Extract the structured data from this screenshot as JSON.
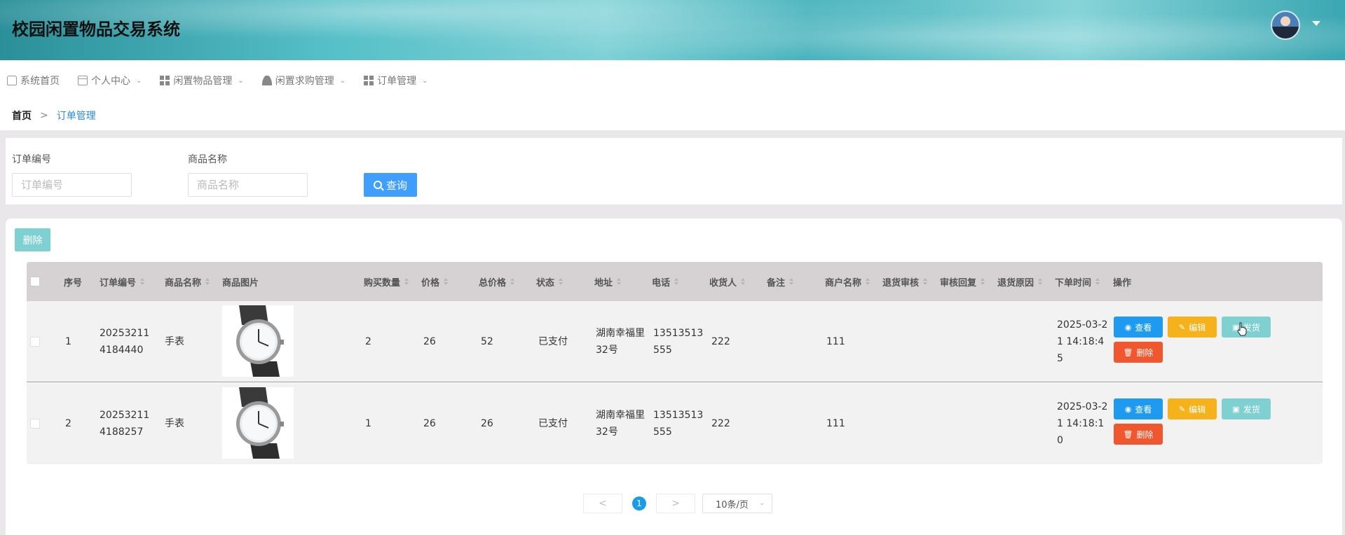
{
  "app": {
    "title": "校园闲置物品交易系统"
  },
  "nav": {
    "items": [
      {
        "label": "系统首页",
        "icon": "home-icon",
        "has_dropdown": false
      },
      {
        "label": "个人中心",
        "icon": "card-icon",
        "has_dropdown": true
      },
      {
        "label": "闲置物品管理",
        "icon": "grid-icon",
        "has_dropdown": true
      },
      {
        "label": "闲置求购管理",
        "icon": "user-icon",
        "has_dropdown": true
      },
      {
        "label": "订单管理",
        "icon": "grid-icon",
        "has_dropdown": true
      }
    ]
  },
  "breadcrumb": {
    "home": "首页",
    "separator": ">",
    "current": "订单管理"
  },
  "search": {
    "order_no_label": "订单编号",
    "order_no_placeholder": "订单编号",
    "product_label": "商品名称",
    "product_placeholder": "商品名称",
    "query_button": "查询"
  },
  "toolbar": {
    "delete_label": "删除"
  },
  "table": {
    "columns": [
      "序号",
      "订单编号",
      "商品名称",
      "商品图片",
      "购买数量",
      "价格",
      "总价格",
      "状态",
      "地址",
      "电话",
      "收货人",
      "备注",
      "商户名称",
      "退货审核",
      "审核回复",
      "退货原因",
      "下单时间",
      "操作"
    ],
    "rows": [
      {
        "index": "1",
        "order_no": "202532114184440",
        "product": "手表",
        "quantity": "2",
        "price": "26",
        "total": "52",
        "status": "已支付",
        "address": "湖南幸福里32号",
        "phone": "13513513555",
        "receiver": "222",
        "note": "",
        "merchant": "111",
        "return_review": "",
        "review_reply": "",
        "return_reason": "",
        "order_time": "2025-03-21 14:18:45"
      },
      {
        "index": "2",
        "order_no": "202532114188257",
        "product": "手表",
        "quantity": "1",
        "price": "26",
        "total": "26",
        "status": "已支付",
        "address": "湖南幸福里32号",
        "phone": "13513513555",
        "receiver": "222",
        "note": "",
        "merchant": "111",
        "return_review": "",
        "review_reply": "",
        "return_reason": "",
        "order_time": "2025-03-21 14:18:10"
      }
    ],
    "actions": {
      "view": "查看",
      "edit": "编辑",
      "ship": "发货",
      "delete": "删除"
    }
  },
  "pagination": {
    "prev": "<",
    "current": "1",
    "next": ">",
    "page_size": "10条/页"
  },
  "colors": {
    "primary": "#409eff",
    "view": "#1e9bf0",
    "edit": "#f6b21a",
    "ship": "#7fd0d1",
    "delete": "#f1572e",
    "breadcrumb_active": "#2b8ad8",
    "header_bg": "#57c0c8"
  }
}
